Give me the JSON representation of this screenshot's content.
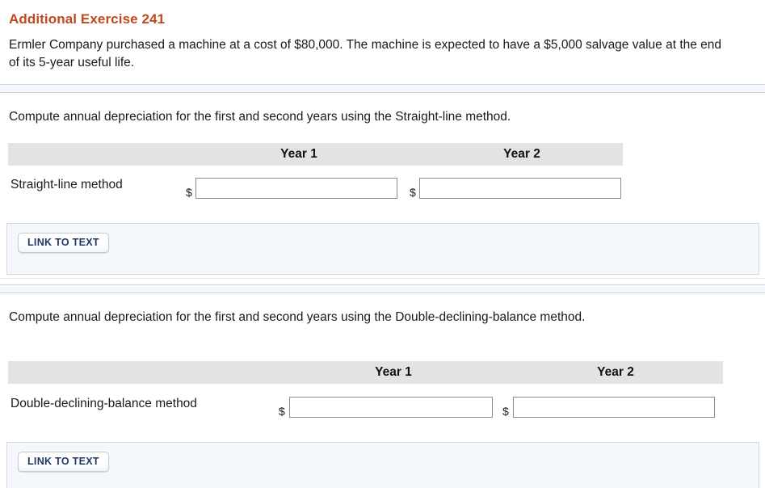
{
  "exercise": {
    "title": "Additional Exercise 241",
    "description": "Ermler Company purchased a machine at a cost of $80,000. The machine is expected to have a $5,000 salvage value at the end of its 5-year useful life."
  },
  "sections": [
    {
      "prompt": "Compute annual depreciation for the first and second years using the Straight-line method.",
      "table": {
        "row_header": "",
        "columns": [
          "Year 1",
          "Year 2"
        ],
        "row_label": "Straight-line method",
        "currency_symbol": "$",
        "inputs": [
          {
            "value": "",
            "placeholder": ""
          },
          {
            "value": "",
            "placeholder": ""
          }
        ]
      },
      "link_button": "LINK TO TEXT"
    },
    {
      "prompt": "Compute annual depreciation for the first and second years using the Double-declining-balance method.",
      "table": {
        "row_header": "",
        "columns": [
          "Year 1",
          "Year 2"
        ],
        "row_label": "Double-declining-balance method",
        "currency_symbol": "$",
        "inputs": [
          {
            "value": "",
            "placeholder": ""
          },
          {
            "value": "",
            "placeholder": ""
          }
        ]
      },
      "link_button": "LINK TO TEXT"
    }
  ],
  "colors": {
    "title": "#c0491b",
    "table_header_bg": "#e3e3e3",
    "panel_bg": "#f4f8fc",
    "button_text": "#1f3864",
    "band_bg": "#f4f7fb"
  }
}
